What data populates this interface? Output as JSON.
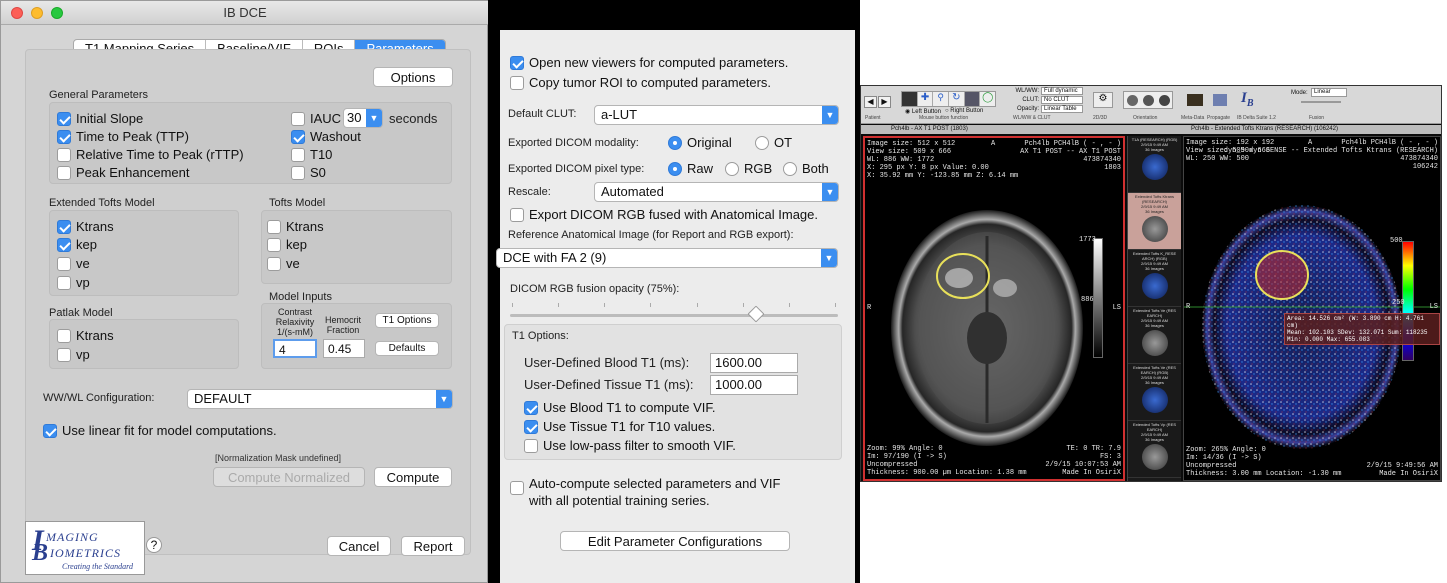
{
  "window": {
    "title": "IB DCE"
  },
  "tabs": [
    {
      "label": "T1 Mapping Series"
    },
    {
      "label": "Baseline/VIF"
    },
    {
      "label": "ROIs"
    },
    {
      "label": "Parameters"
    }
  ],
  "options_button": "Options",
  "general": {
    "title": "General Parameters",
    "initial_slope": "Initial Slope",
    "ttp": "Time to Peak (TTP)",
    "rttp": "Relative Time to Peak (rTTP)",
    "peak_enh": "Peak Enhancement",
    "iauc": "IAUC",
    "iauc_value": "30",
    "seconds": "seconds",
    "washout": "Washout",
    "t10": "T10",
    "s0": "S0"
  },
  "ext_tofts": {
    "title": "Extended Tofts Model",
    "items": [
      "Ktrans",
      "kep",
      "ve",
      "vp"
    ]
  },
  "tofts": {
    "title": "Tofts Model",
    "items": [
      "Ktrans",
      "kep",
      "ve"
    ]
  },
  "patlak": {
    "title": "Patlak Model",
    "items": [
      "Ktrans",
      "vp"
    ]
  },
  "model_inputs": {
    "title": "Model Inputs",
    "contrast_l1": "Contrast",
    "contrast_l2": "Relaxivity",
    "contrast_l3": "1/(s-mM)",
    "hemo_l1": "Hemocrit",
    "hemo_l2": "Fraction",
    "relaxivity": "4",
    "hemocrit": "0.45",
    "t1_options": "T1 Options",
    "defaults": "Defaults"
  },
  "wwwl": {
    "label": "WW/WL Configuration:",
    "value": "DEFAULT"
  },
  "linear_fit": "Use linear fit for model computations.",
  "norm_mask": "[Normalization Mask undefined]",
  "compute_normalized": "Compute Normalized",
  "compute": "Compute",
  "logo": {
    "l1": "MAGING",
    "l2": "IOMETRICS",
    "tagline": "Creating the Standard"
  },
  "help": "?",
  "cancel": "Cancel",
  "report": "Report",
  "panel2": {
    "open_viewers": "Open new viewers for computed parameters.",
    "copy_roi": "Copy tumor ROI to computed parameters.",
    "clut_label": "Default CLUT:",
    "clut_value": "a-LUT",
    "modality_label": "Exported DICOM modality:",
    "modality_opts": [
      "Original",
      "OT"
    ],
    "pixel_label": "Exported DICOM pixel type:",
    "pixel_opts": [
      "Raw",
      "RGB",
      "Both"
    ],
    "rescale_label": "Rescale:",
    "rescale_value": "Automated",
    "export_rgb": "Export DICOM RGB fused with Anatomical Image.",
    "ref_label": "Reference Anatomical Image (for Report and RGB export):",
    "ref_value": "DCE with FA 2 (9)",
    "fusion_label": "DICOM RGB fusion opacity (75%):",
    "fusion_value": 0.75,
    "t1_options": "T1 Options:",
    "blood_label": "User-Defined Blood T1 (ms):",
    "blood_value": "1600.00",
    "tissue_label": "User-Defined Tissue T1 (ms):",
    "tissue_value": "1000.00",
    "use_blood": "Use Blood T1 to compute VIF.",
    "use_tissue": "Use Tissue T1 for T10 values.",
    "lowpass": "Use low-pass filter to smooth VIF.",
    "auto_l1": "Auto-compute selected parameters and VIF",
    "auto_l2": "with all potential training series.",
    "edit_configs": "Edit Parameter Configurations"
  },
  "osirix": {
    "toolbar": {
      "patient": "Patient",
      "mouse": "Mouse button function",
      "wwwl": "WL/WW & CLUT",
      "d2d3": "2D/3D",
      "orientation": "Orientation",
      "meta": "Meta-Data",
      "propagate": "Propagate",
      "suite": "IB Delta Suite 1.2",
      "fusion": "Fusion",
      "left_btn": "Left Button",
      "right_btn": "Right Button",
      "wlww_val": "Full dynamic",
      "clut_val": "No CLUT",
      "opacity_val": "Linear Table",
      "mode_label": "Mode:",
      "mode_val": "Linear",
      "wlww_lbl": "WL/WW:",
      "clut_lbl": "CLUT:",
      "opacity_lbl": "Opacity:"
    },
    "left_tab": "Pch4lb - AX T1 POST (1803)",
    "right_tab": "Pch4lb - Extended Tofts Ktrans (RESEARCH) (106242)",
    "left_view": {
      "tl1": "Image size: 512 x 512",
      "tl2": "View size: 509 x 666",
      "tl3": "WL: 886 WW: 1772",
      "tl4": "X: 295 px Y: 8 px Value: 0.00",
      "tl5": "X: 35.92 mm Y: -123.85 mm Z: 6.14 mm",
      "tr1": "Pch4lb PCH4lB ( - , - )",
      "tr2": "AX T1 POST -- AX T1 POST",
      "tr3": "473874340",
      "tr4": "1803",
      "top": "A",
      "left": "R",
      "right": "LS",
      "bar_max": "1773",
      "bar_mid": "886",
      "bl1": "Zoom: 99% Angle: 0",
      "bl2": "Im: 97/190 (I -> S)",
      "bl3": "Uncompressed",
      "bl4": "Thickness: 900.00 µm Location: 1.38 mm",
      "br1": "TE: 0 TR: 7.9",
      "br2": "FS: 3",
      "br3": "2/9/15 10:07:53 AM",
      "br4": "Made In OsiriX"
    },
    "right_view": {
      "tl1": "Image size: 192 x 192",
      "tl2": "View size: 509 x 666",
      "tl3": "WL: 250 WW: 500",
      "tr1": "Pch4lb PCH4lB ( - , - )",
      "tr2": "dyn_50dyn SENSE -- Extended Tofts Ktrans (RESEARCH)",
      "tr3": "473874340",
      "tr4": "106242",
      "top": "A",
      "left": "R",
      "right": "LS",
      "bar_max": "500",
      "bar_mid": "250",
      "roi1": "Area: 14.526 cm² (W: 3.890 cm H: 4.761 cm)",
      "roi2": "Mean: 102.103  SDev: 132.071  Sum: 118235",
      "roi3": "Min: 0.000  Max: 655.083",
      "bl1": "Zoom: 265% Angle: 0",
      "bl2": "Im: 14/36 (I -> S)",
      "bl3": "Uncompressed",
      "bl4": "Thickness: 3.00 mm Location: -1.30 mm",
      "br3": "2/9/15 9:49:56 AM",
      "br4": "Made In OsiriX"
    },
    "series": [
      {
        "l1": "T1A (RESEARCH) (RGB)",
        "l2": "2/9/15 9:49 AM",
        "l3": "36 Images"
      },
      {
        "l1": "Extended Tofts Ktrans (RESEARCH)",
        "l2": "2/9/15 9:49 AM",
        "l3": "36 Images"
      },
      {
        "l1": "Extended Tofts K_RESE ARCH) (RGB)",
        "l2": "2/9/15 9:49 AM",
        "l3": "36 Images"
      },
      {
        "l1": "Extended Tofts Ve (RES EARCH)",
        "l2": "2/9/15 9:49 AM",
        "l3": "36 Images"
      },
      {
        "l1": "Extended Tofts Ve (RES EARCH) (RGB)",
        "l2": "2/9/15 9:49 AM",
        "l3": "36 Images"
      },
      {
        "l1": "Extended Tofts Vp (RES EARCH)",
        "l2": "2/9/15 9:49 AM",
        "l3": "36 Images"
      }
    ]
  },
  "colors": {
    "accent": "#3b8ef0",
    "window_bg": "#d5d5d5",
    "roi": "#e8e05a",
    "selection": "#d03030"
  }
}
